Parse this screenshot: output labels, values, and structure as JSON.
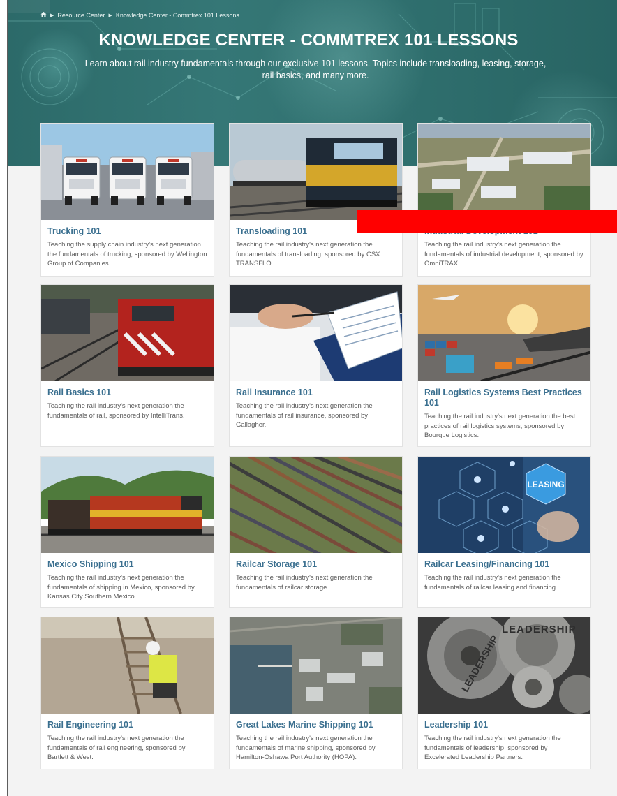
{
  "breadcrumb": {
    "items": [
      "Resource Center",
      "Knowledge Center - Commtrex 101 Lessons"
    ]
  },
  "hero": {
    "title": "KNOWLEDGE CENTER - COMMTREX 101 LESSONS",
    "description": "Learn about rail industry fundamentals through our exclusive 101 lessons. Topics include transloading, leasing, storage, rail basics, and many more."
  },
  "colors": {
    "hero_teal": "#2f6f6e",
    "card_title": "#3a6f8f",
    "page_bg": "#f3f3f3",
    "redaction": "#ff0000"
  },
  "cards": [
    {
      "title": "Trucking 101",
      "description": "Teaching the supply chain industry's next generation the fundamentals of trucking, sponsored by Wellington Group of Companies.",
      "image": "trucks-photo"
    },
    {
      "title": "Transloading 101",
      "description": "Teaching the rail industry's next generation the fundamentals of transloading, sponsored by CSX TRANSFLO.",
      "image": "locomotive-tank-car-photo"
    },
    {
      "title": "Industrial Development 101",
      "description": "Teaching the rail industry's next generation the fundamentals of industrial development, sponsored by OmniTRAX.",
      "image": "industrial-park-aerial-photo"
    },
    {
      "title": "Rail Basics 101",
      "description": "Teaching the rail industry's next generation the fundamentals of rail, sponsored by IntelliTrans.",
      "image": "red-locomotive-photo"
    },
    {
      "title": "Rail Insurance 101",
      "description": "Teaching the rail industry's next generation the fundamentals of rail insurance, sponsored by Gallagher.",
      "image": "signing-documents-photo"
    },
    {
      "title": "Rail Logistics Systems Best Practices 101",
      "description": "Teaching the rail industry's next generation the best practices of rail logistics systems, sponsored by Bourque Logistics.",
      "image": "logistics-port-photo"
    },
    {
      "title": "Mexico Shipping 101",
      "description": "Teaching the rail industry's next generation the fundamentals of shipping in Mexico, sponsored by Kansas City Southern Mexico.",
      "image": "ksc-locomotive-photo"
    },
    {
      "title": "Railcar Storage 101",
      "description": "Teaching the rail industry's next generation the fundamentals of railcar storage.",
      "image": "rail-yard-aerial-photo"
    },
    {
      "title": "Railcar Leasing/Financing 101",
      "description": "Teaching the rail industry's next generation the fundamentals of railcar leasing and financing.",
      "image": "leasing-hexagon-photo",
      "image_text": "LEASING"
    },
    {
      "title": "Rail Engineering 101",
      "description": "Teaching the rail industry's next generation the fundamentals of rail engineering, sponsored by Bartlett & West.",
      "image": "track-inspector-photo"
    },
    {
      "title": "Great Lakes Marine Shipping 101",
      "description": "Teaching the rail industry's next generation the fundamentals of marine shipping, sponsored by Hamilton-Oshawa Port Authority (HOPA).",
      "image": "port-aerial-photo"
    },
    {
      "title": "Leadership 101",
      "description": "Teaching the rail industry's next generation the fundamentals of leadership, sponsored by Excelerated Leadership Partners.",
      "image": "leadership-gears-photo",
      "image_text": [
        "LEADERSHIP",
        "LEADERSHIP"
      ]
    }
  ]
}
